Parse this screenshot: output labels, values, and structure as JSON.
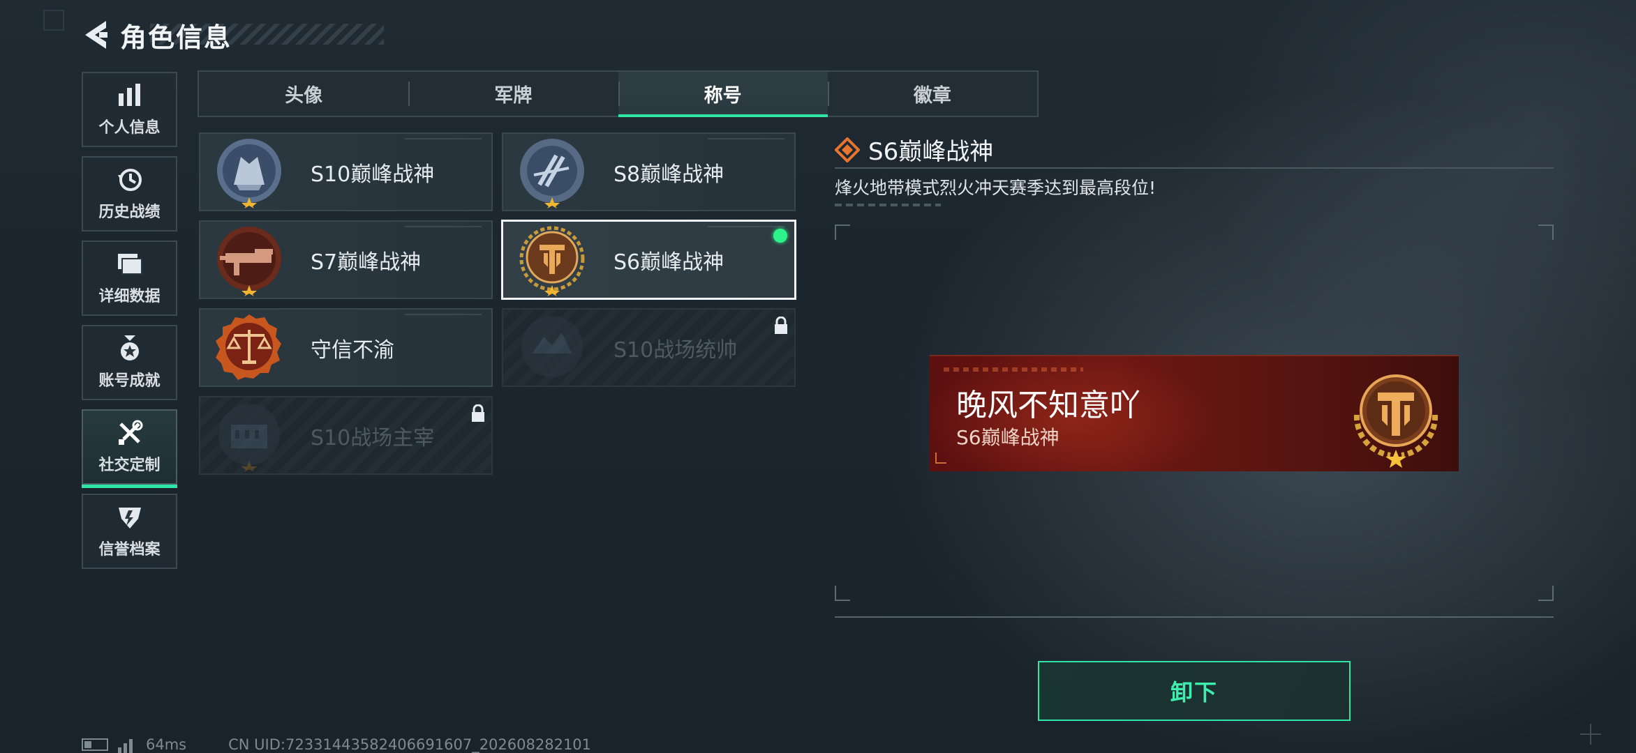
{
  "header": {
    "title": "角色信息"
  },
  "sidebar": {
    "items": [
      {
        "label": "个人信息",
        "icon": "bar-chart-icon"
      },
      {
        "label": "历史战绩",
        "icon": "history-icon"
      },
      {
        "label": "详细数据",
        "icon": "folder-icon"
      },
      {
        "label": "账号成就",
        "icon": "medal-icon"
      },
      {
        "label": "社交定制",
        "icon": "tools-icon",
        "active": true
      },
      {
        "label": "信誉档案",
        "icon": "credit-shield-icon"
      }
    ]
  },
  "tabs": [
    {
      "label": "头像"
    },
    {
      "label": "军牌"
    },
    {
      "label": "称号",
      "active": true
    },
    {
      "label": "徽章"
    }
  ],
  "titles": [
    {
      "name": "S10巅峰战神",
      "locked": false
    },
    {
      "name": "S8巅峰战神",
      "locked": false
    },
    {
      "name": "S7巅峰战神",
      "locked": false
    },
    {
      "name": "S6巅峰战神",
      "locked": false,
      "selected": true,
      "equipped": true
    },
    {
      "name": "守信不渝",
      "locked": false
    },
    {
      "name": "S10战场统帅",
      "locked": true
    },
    {
      "name": "S10战场主宰",
      "locked": true
    }
  ],
  "detail": {
    "title": "S6巅峰战神",
    "description": "烽火地带模式烈火冲天赛季达到最高段位!"
  },
  "nameplate": {
    "player_name": "晚风不知意吖",
    "title": "S6巅峰战神"
  },
  "actions": {
    "unequip_label": "卸下"
  },
  "status": {
    "ping": "64ms",
    "uid": "CN UID:72331443582406691607_202608282101"
  },
  "colors": {
    "accent": "#2ee6a6",
    "equipped_dot": "#2ef28a",
    "nameplate_red": "#6e1712"
  }
}
